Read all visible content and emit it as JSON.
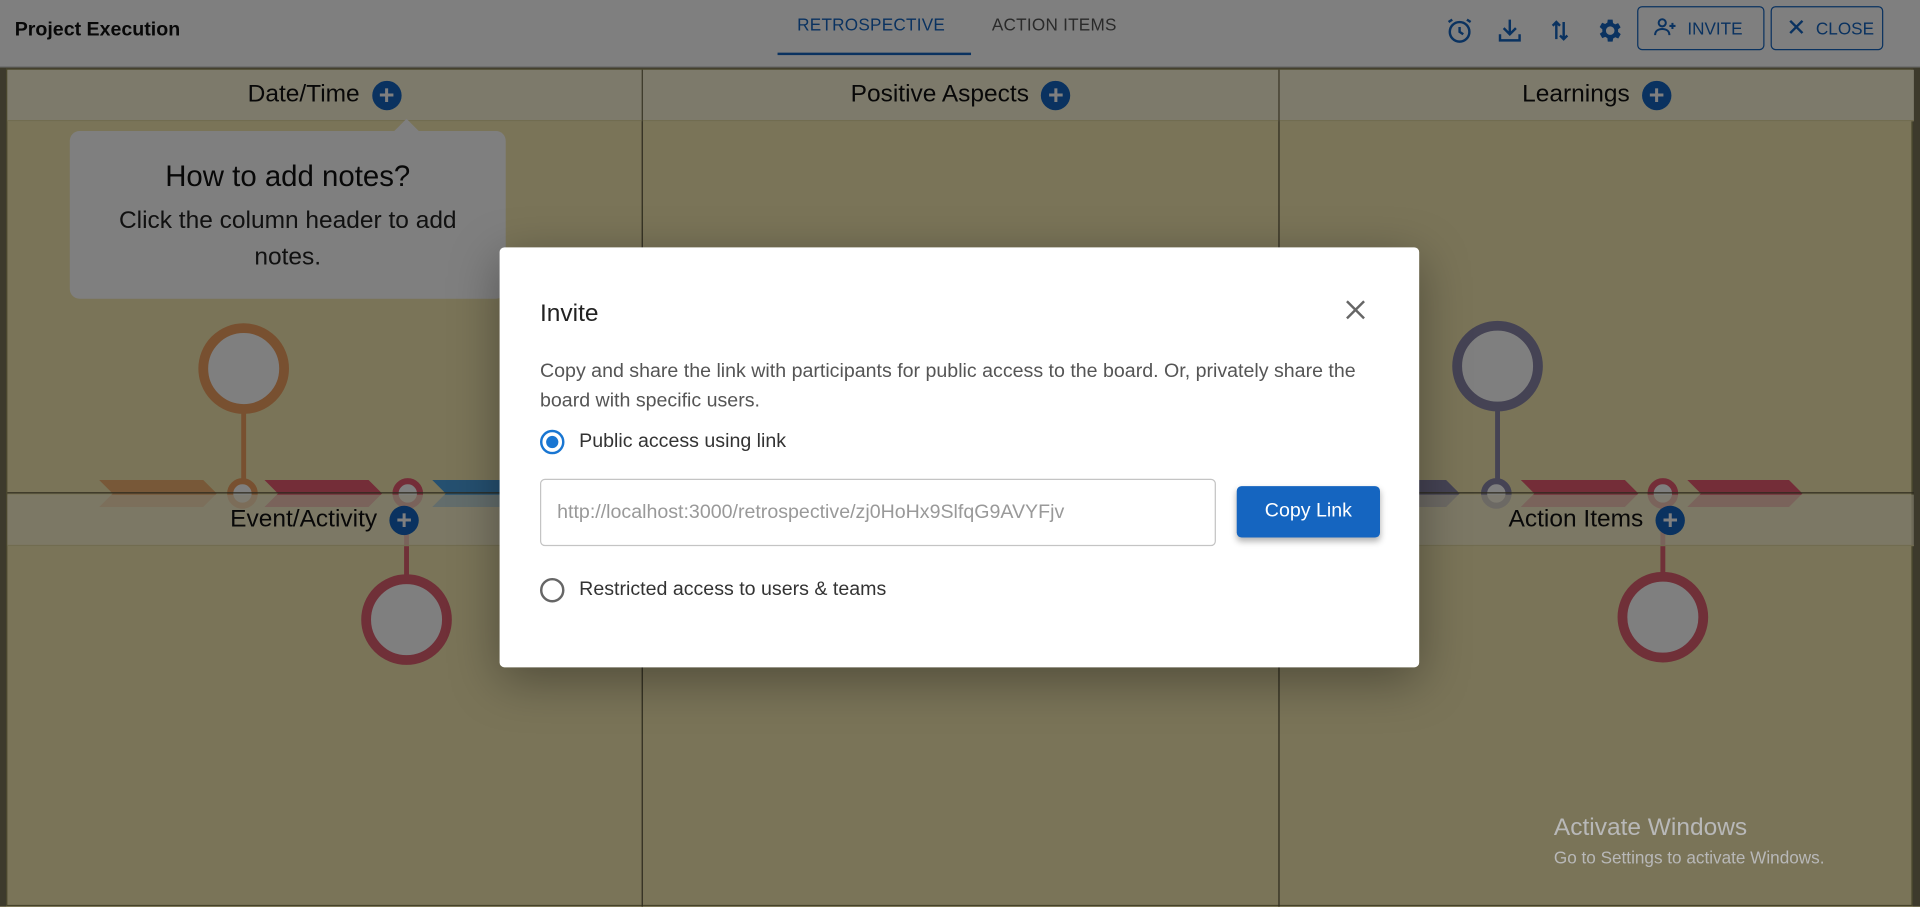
{
  "header": {
    "title": "Project Execution",
    "tabs": [
      {
        "label": "RETROSPECTIVE",
        "active": true
      },
      {
        "label": "ACTION ITEMS",
        "active": false
      }
    ],
    "icons": [
      "alarm-icon",
      "download-icon",
      "sort-icon",
      "gear-icon"
    ],
    "invite_label": "INVITE",
    "close_label": "CLOSE"
  },
  "board": {
    "columns": [
      {
        "label": "Date/Time"
      },
      {
        "label": "Positive Aspects"
      },
      {
        "label": "Learnings"
      },
      {
        "label": "Event/Activity"
      },
      {
        "label": "Action Items"
      }
    ],
    "tooltip": {
      "title": "How to add notes?",
      "body": "Click the column header to add notes."
    }
  },
  "modal": {
    "title": "Invite",
    "description": "Copy and share the link with participants for public access to the board. Or, privately share the board with specific users.",
    "options": [
      {
        "label": "Public access using link",
        "selected": true
      },
      {
        "label": "Restricted access to users & teams",
        "selected": false
      }
    ],
    "link_value": "http://localhost:3000/retrospective/zj0HoHx9SlfqG9AVYFjv",
    "copy_label": "Copy Link"
  },
  "watermark": {
    "title": "Activate Windows",
    "subtitle": "Go to Settings to activate Windows."
  },
  "colors": {
    "accent": "#1565c0",
    "board_bg": "#f4e8b0"
  }
}
